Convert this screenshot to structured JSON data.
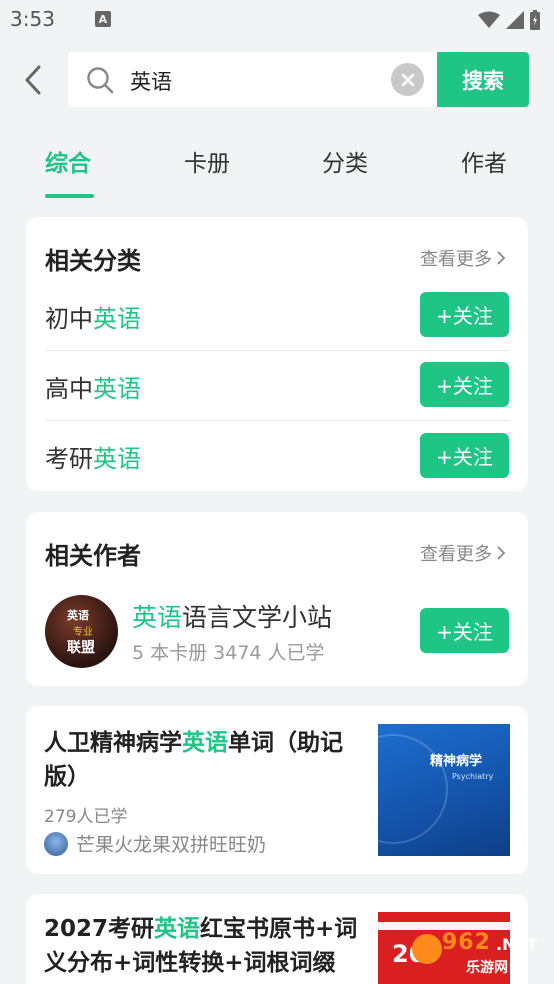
{
  "status_bar": {
    "time": "3:53",
    "notif_letter": "A"
  },
  "search": {
    "query": "英语",
    "button_label": "搜索"
  },
  "tabs": [
    {
      "label": "综合",
      "active": true
    },
    {
      "label": "卡册",
      "active": false
    },
    {
      "label": "分类",
      "active": false
    },
    {
      "label": "作者",
      "active": false
    }
  ],
  "related_categories": {
    "title": "相关分类",
    "more_label": "查看更多",
    "items": [
      {
        "prefix": "初中",
        "highlight": "英语",
        "follow_label": "+关注"
      },
      {
        "prefix": "高中",
        "highlight": "英语",
        "follow_label": "+关注"
      },
      {
        "prefix": "考研",
        "highlight": "英语",
        "follow_label": "+关注"
      }
    ]
  },
  "related_authors": {
    "title": "相关作者",
    "more_label": "查看更多",
    "author": {
      "highlight": "英语",
      "name_rest": "语言文学小站",
      "meta": "5 本卡册  3474 人已学",
      "follow_label": "+关注",
      "avatar_text": [
        "英语",
        "专业",
        "联盟"
      ]
    }
  },
  "books": [
    {
      "title_before": "人卫精神病学",
      "title_highlight": "英语",
      "title_after": "单词（助记版）",
      "learners": "279人已学",
      "author": "芒果火龙果双拼旺旺奶",
      "cover_title": "精神病学",
      "cover_sub": "Psychiatry"
    },
    {
      "title_before": "2027考研",
      "title_highlight": "英语",
      "title_after": "红宝书原书+词义分布+词性转换+词根词缀+柯林",
      "cover_text": "20"
    }
  ],
  "watermark": {
    "num": "962",
    "net": ".NET",
    "sub": "乐游网"
  },
  "colors": {
    "accent": "#1ec585",
    "background": "#f2f3f5"
  }
}
